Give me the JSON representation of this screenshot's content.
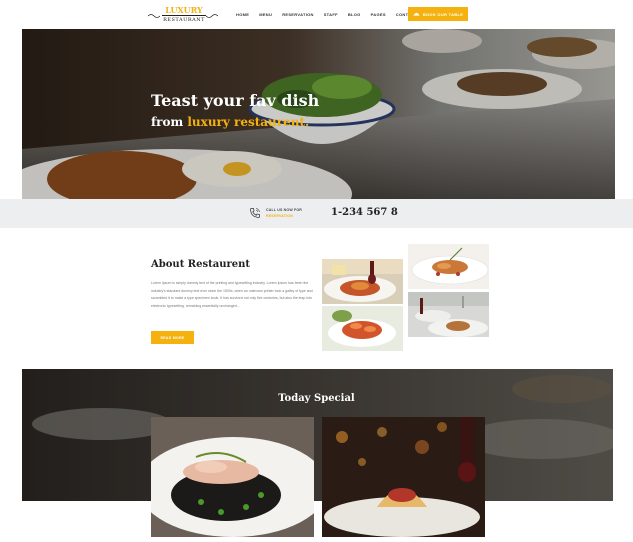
{
  "header": {
    "logo": {
      "line1": "LUXURY",
      "line2": "RESTAURANT"
    },
    "nav": [
      "HOME",
      "MENU",
      "RESERVATION",
      "STAFF",
      "BLOG",
      "PAGES",
      "CONTACT"
    ],
    "book_button": {
      "label": "BOOK OUR TABLE",
      "icon": "dish-icon"
    }
  },
  "hero": {
    "line1": "Teast your fav dish",
    "line2_prefix": "from ",
    "line2_highlight": "luxury restaurent."
  },
  "contact": {
    "label1": "CALL US NOW FOR",
    "label2": "RESERVATION",
    "phone": "1-234 567 8",
    "icon": "phone-icon"
  },
  "about": {
    "title": "About Restaurent",
    "body": "Lorem Ipsum is simply dummy text of the printing and typesetting industry. Lorem Ipsum has been the industry's standard dummy text ever since the 1500s, when an unknown printer took a galley of type and scrambled it to make a type specimen book. It has survived not only five centuries, but also the leap into electronic typesetting, remaining essentially unchanged...",
    "button": "READ MORE"
  },
  "special": {
    "title": "Today Special"
  },
  "colors": {
    "accent": "#f5b20f",
    "strip_bg": "#eceeef",
    "heading": "#222222"
  }
}
